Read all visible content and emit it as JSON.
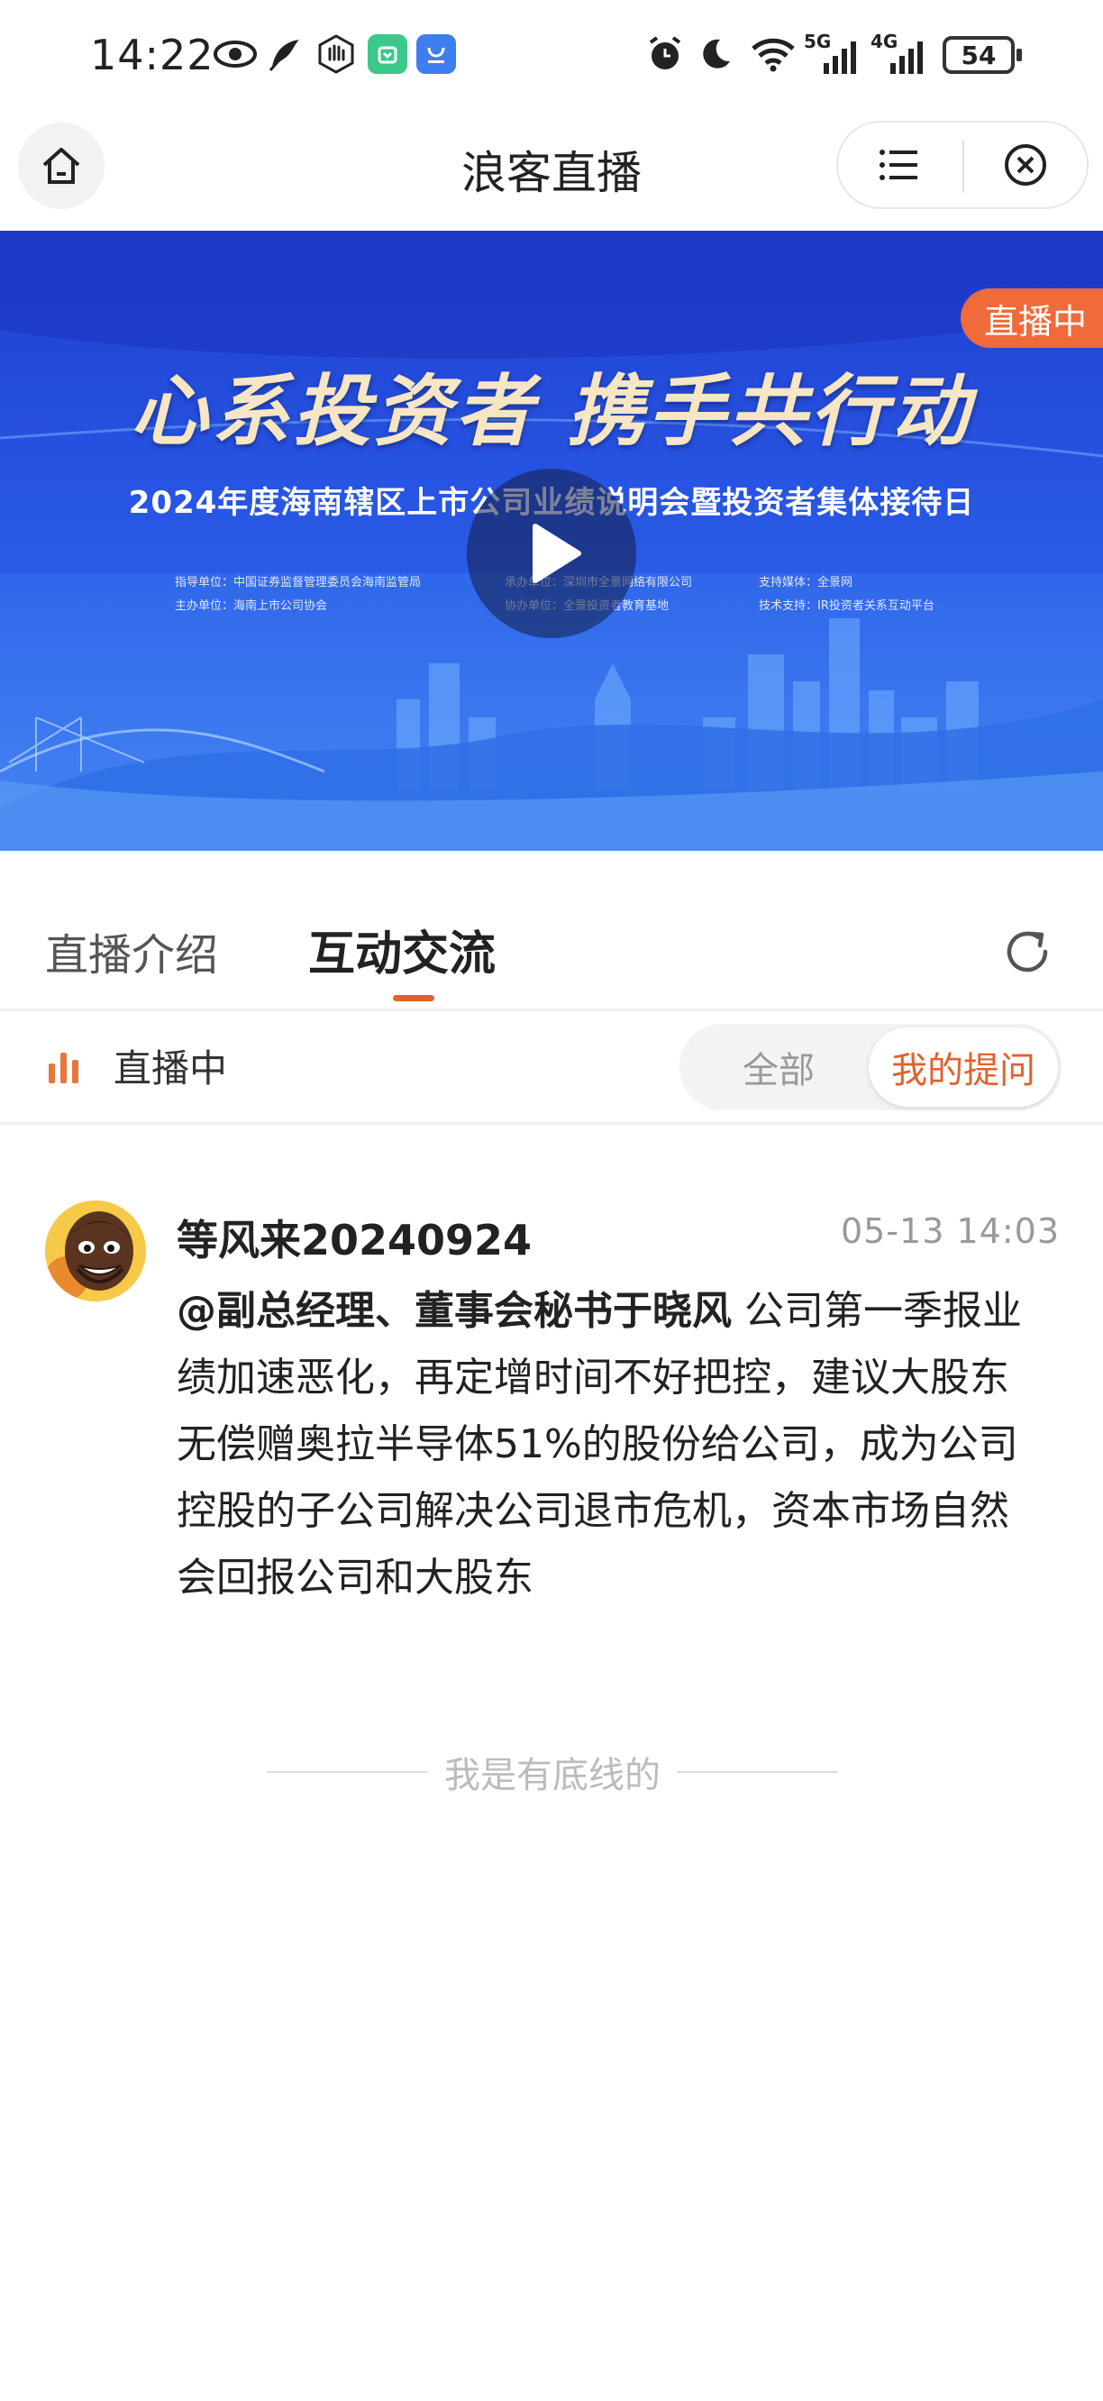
{
  "status_bar": {
    "time": "14:22",
    "battery": "54",
    "network_5g": "5G",
    "network_4g": "4G",
    "icons": [
      "eye-icon",
      "leaf-icon",
      "hand-icon",
      "app-icon-green",
      "app-icon-blue",
      "alarm-icon",
      "moon-icon",
      "wifi-icon",
      "signal-icon",
      "battery-icon"
    ]
  },
  "header": {
    "title": "浪客直播",
    "home_icon": "home-icon",
    "menu_icon": "menu-icon",
    "close_icon": "close-circle-icon"
  },
  "banner": {
    "live_badge": "直播中",
    "slogan": "心系投资者 携手共行动",
    "event_title": "2024年度海南辖区上市公司业绩说明会暨投资者集体接待日",
    "credits_col1": [
      "指导单位：中国证券监督管理委员会海南监管局",
      "主办单位：海南上市公司协会"
    ],
    "credits_col2": [
      "承办单位：深圳市全景网络有限公司",
      "协办单位：全景投资者教育基地"
    ],
    "credits_col3": [
      "支持媒体：全景网",
      "技术支持：IR投资者关系互动平台"
    ],
    "play_icon": "play-icon"
  },
  "tabs": {
    "items": [
      {
        "label": "直播介绍",
        "active": false
      },
      {
        "label": "互动交流",
        "active": true
      }
    ],
    "refresh_icon": "refresh-icon",
    "accent": "#e0622e"
  },
  "filter": {
    "live_label": "直播中",
    "options": [
      "全部",
      "我的提问"
    ],
    "selected": "我的提问"
  },
  "post": {
    "username": "等风来20240924",
    "time": "05-13 14:03",
    "mention": "@副总经理、董事会秘书于晓风",
    "text": " 公司第一季报业绩加速恶化，再定增时间不好把控，建议大股东无偿赠奥拉半导体51%的股份给公司，成为公司控股的子公司解决公司退市危机，资本市场自然会回报公司和大股东"
  },
  "footer_note": "我是有底线的"
}
